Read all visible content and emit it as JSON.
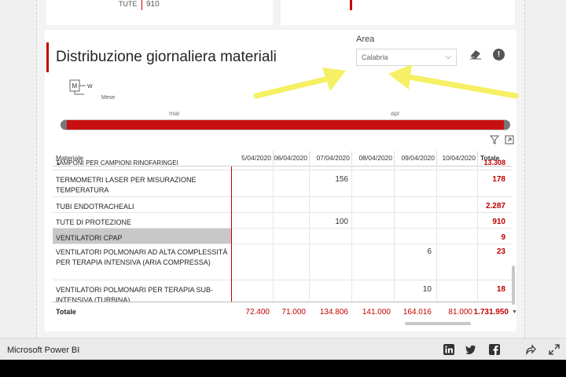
{
  "kpi": {
    "label": "TUTE",
    "value": "910"
  },
  "title": "Distribuzione giornaliera materiali",
  "area_filter": {
    "label": "Area",
    "value": "Calabria"
  },
  "slicer": {
    "hierarchy_top": "M",
    "hierarchy_right": "W",
    "hierarchy_label": "Mese",
    "months": [
      "mar",
      "apr"
    ]
  },
  "matrix": {
    "row_header": "Materiale",
    "columns": [
      "5/04/2020",
      "06/04/2020",
      "07/04/2020",
      "08/04/2020",
      "09/04/2020",
      "10/04/2020",
      "Totale"
    ],
    "partial_row": {
      "label": "TAMPONI PER CAMPIONI RINOFARINGEI",
      "total": "13.308"
    },
    "rows": [
      {
        "label": "TERMOMETRI LASER PER MISURAZIONE TEMPERATURA",
        "values": [
          "",
          "",
          "156",
          "",
          "",
          ""
        ],
        "total": "178"
      },
      {
        "label": "TUBI ENDOTRACHEALI",
        "values": [
          "",
          "",
          "",
          "",
          "",
          ""
        ],
        "total": "2.287"
      },
      {
        "label": "TUTE DI PROTEZIONE",
        "values": [
          "",
          "",
          "100",
          "",
          "",
          ""
        ],
        "total": "910"
      },
      {
        "label": "VENTILATORI CPAP",
        "values": [
          "",
          "",
          "",
          "",
          "",
          ""
        ],
        "total": "9",
        "selected": true
      },
      {
        "label": "VENTILATORI POLMONARI AD ALTA COMPLESSITÀ PER TERAPIA INTENSIVA (ARIA COMPRESSA)",
        "values": [
          "",
          "",
          "",
          "",
          "6",
          ""
        ],
        "total": "23"
      },
      {
        "label": "VENTILATORI POLMONARI PER TERAPIA SUB-INTENSIVA (TURBINA)",
        "values": [
          "",
          "",
          "",
          "",
          "10",
          ""
        ],
        "total": "18"
      }
    ],
    "total_label": "Totale",
    "totals": [
      "72.400",
      "71.000",
      "134.806",
      "141.000",
      "164.016",
      "81.000",
      "1.731.950"
    ]
  },
  "footer": {
    "brand": "Microsoft Power BI"
  },
  "colors": {
    "accent": "#c00000",
    "arrow": "#f5f064",
    "slider": "#c81010"
  },
  "icons": [
    "eraser-icon",
    "info-icon",
    "hierarchy-icon",
    "filter-icon",
    "focus-mode-icon",
    "linkedin-icon",
    "twitter-icon",
    "facebook-icon",
    "share-icon",
    "fullscreen-icon"
  ]
}
